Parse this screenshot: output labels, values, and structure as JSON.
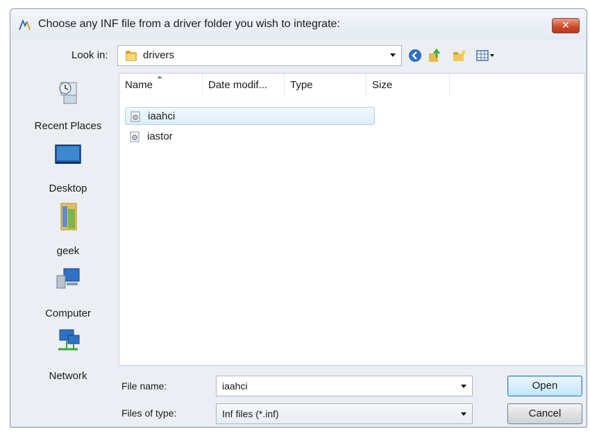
{
  "window": {
    "title": "Choose any INF file from a driver folder you wish to integrate:",
    "close_label": "✕"
  },
  "lookin": {
    "label": "Look in:",
    "value": "drivers"
  },
  "toolbar": {
    "icons": [
      "back-icon",
      "up-folder-icon",
      "new-folder-icon",
      "view-menu-icon"
    ]
  },
  "places": [
    {
      "label": "Recent Places",
      "icon": "recent-places-icon"
    },
    {
      "label": "Desktop",
      "icon": "desktop-icon"
    },
    {
      "label": "geek",
      "icon": "user-folder-icon"
    },
    {
      "label": "Computer",
      "icon": "computer-icon"
    },
    {
      "label": "Network",
      "icon": "network-icon"
    }
  ],
  "columns": [
    "Name",
    "Date modif...",
    "Type",
    "Size"
  ],
  "files": [
    {
      "name": "iaahci",
      "selected": true
    },
    {
      "name": "iastor",
      "selected": false
    }
  ],
  "bottom": {
    "filename_label": "File name:",
    "filename_value": "iaahci",
    "filetype_label": "Files of type:",
    "filetype_value": "Inf files (*.inf)",
    "open_label": "Open",
    "cancel_label": "Cancel"
  },
  "colors": {
    "selection": "#dceefb",
    "close_button": "#cf4d2c",
    "window_bg": "#ebeff4"
  }
}
